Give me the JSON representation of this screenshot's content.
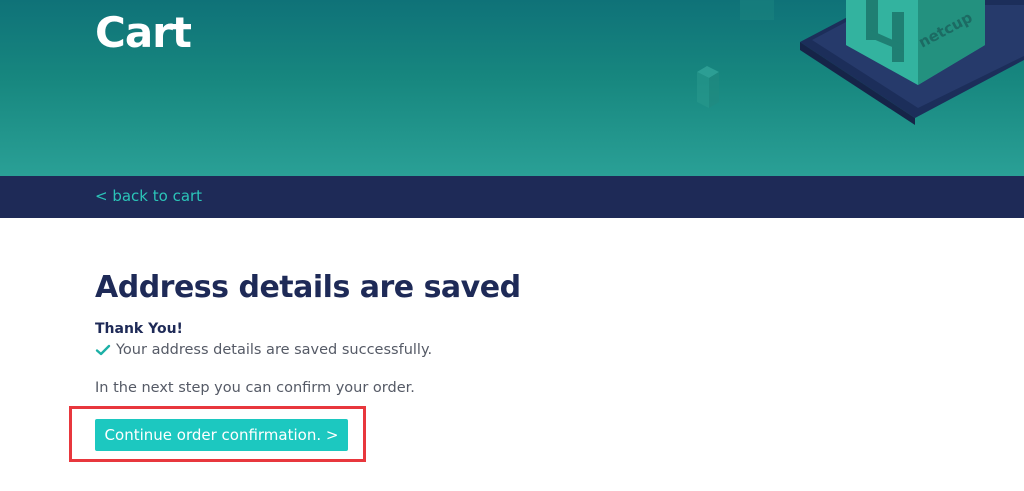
{
  "header": {
    "title": "Cart",
    "logo_text": "netcup"
  },
  "subnav": {
    "back_label": "< back to cart"
  },
  "main": {
    "heading": "Address details are saved",
    "thanks": "Thank You!",
    "success_message": "Your address details are saved successfully.",
    "next_step_text": "In the next step you can confirm your order.",
    "continue_button_label": "Continue order confirmation. >"
  },
  "colors": {
    "header_teal": "#17877f",
    "subnav_navy": "#1e2a57",
    "accent_teal": "#1cc8c0",
    "link_teal": "#2bc4b8",
    "highlight_red": "#e8373d"
  },
  "icons": {
    "success": "check-icon"
  }
}
